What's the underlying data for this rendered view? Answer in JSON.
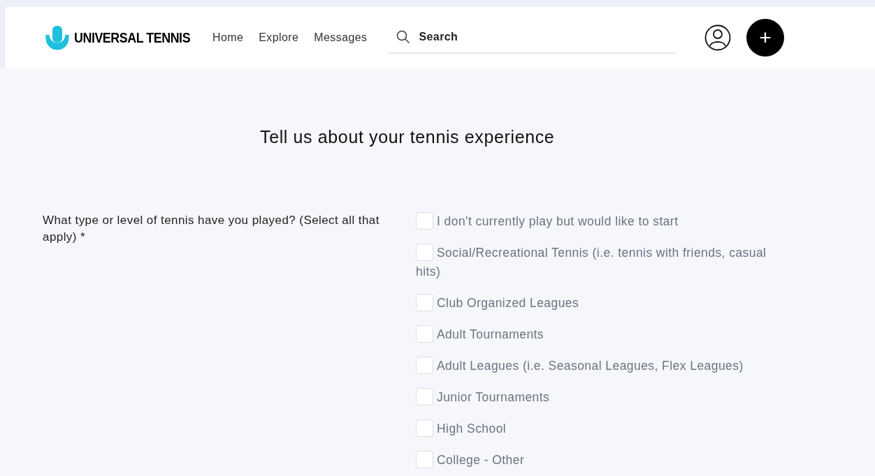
{
  "header": {
    "logo": "UNIVERSAL TENNIS",
    "nav": [
      {
        "label": "Home"
      },
      {
        "label": "Explore"
      },
      {
        "label": "Messages"
      }
    ],
    "search": {
      "placeholder": "Search"
    },
    "add_button": "+"
  },
  "page": {
    "title": "Tell us about your tennis experience"
  },
  "question": {
    "label": "What type or level of tennis have you played? (Select all that apply) *",
    "options": [
      {
        "label": "I don't currently play but would like to start",
        "checked": false
      },
      {
        "label": "Social/Recreational Tennis (i.e. tennis with friends, casual hits)",
        "checked": false
      },
      {
        "label": "Club Organized Leagues",
        "checked": false
      },
      {
        "label": "Adult Tournaments",
        "checked": false
      },
      {
        "label": "Adult Leagues (i.e. Seasonal Leagues, Flex Leagues)",
        "checked": false
      },
      {
        "label": "Junior Tournaments",
        "checked": false
      },
      {
        "label": "High School",
        "checked": false
      },
      {
        "label": "College - Other",
        "checked": false
      }
    ]
  }
}
